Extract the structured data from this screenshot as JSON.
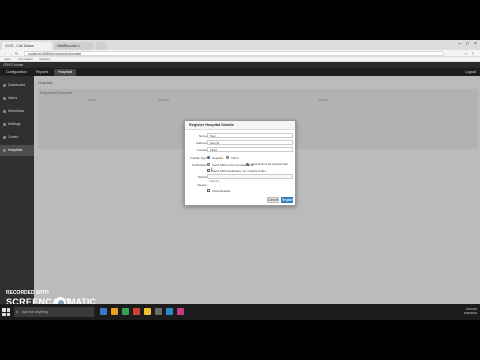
{
  "browser": {
    "tabs": [
      {
        "label": "CIVS - Civil Status"
      },
      {
        "label": "VitalRecords x"
      },
      {
        "label": ""
      }
    ],
    "url": "localhost:8080/civs/admin/hospital",
    "bookmarks": [
      "Apps",
      "Civil Status",
      "Registry"
    ]
  },
  "app": {
    "brand": "CRVS Admin",
    "nav_tabs": [
      "Configuration",
      "Reports",
      "Hospitals"
    ],
    "active_nav": 2,
    "user_label": "Logout"
  },
  "sidebar": {
    "items": [
      {
        "label": "Dashboard"
      },
      {
        "label": "Users"
      },
      {
        "label": "Workflows"
      },
      {
        "label": "Settings"
      },
      {
        "label": "Codes"
      },
      {
        "label": "Hospitals"
      }
    ],
    "active_index": 5
  },
  "main": {
    "breadcrumb": "Hospitals",
    "panel_title": "Registered Hospitals",
    "columns": [
      "Name",
      "Address",
      "Contact"
    ]
  },
  "modal": {
    "title": "Register Hospital Details",
    "fields": {
      "name": {
        "label": "Name",
        "value": "Test"
      },
      "address": {
        "label": "Address",
        "value": "Test St"
      },
      "contact": {
        "label": "Contact",
        "value": "1234"
      },
      "facility_type": {
        "label": "Facility Type",
        "options": [
          "Hospital",
          "Clinic"
        ],
        "selected": 0
      },
      "notification": {
        "label": "Notification",
        "options": [
          "Send SMS to the Hospital Staff",
          "Send Email to the Hospital Staff"
        ],
        "selected": 1
      },
      "checkbox_label": "Send SMS Notification for multiple births",
      "district": {
        "label": "District",
        "value": ""
      },
      "district_hint": "Colombo",
      "region": {
        "label": "Region",
        "value": ""
      },
      "enable_label": "Active/Enable"
    },
    "buttons": {
      "cancel": "Cancel",
      "submit": "Register"
    }
  },
  "watermark": {
    "line1": "RECORDED WITH",
    "brand_left": "SCREENCAST",
    "brand_right": "MATIC"
  },
  "taskbar": {
    "search_placeholder": "Ask me anything",
    "time": "3:54 PM",
    "date": "10/5/2016",
    "icon_colors": [
      "#3c78c8",
      "#e8a020",
      "#3aa050",
      "#d04030",
      "#f0c030",
      "#6a6a6a",
      "#2a8ad0",
      "#c04080"
    ]
  }
}
